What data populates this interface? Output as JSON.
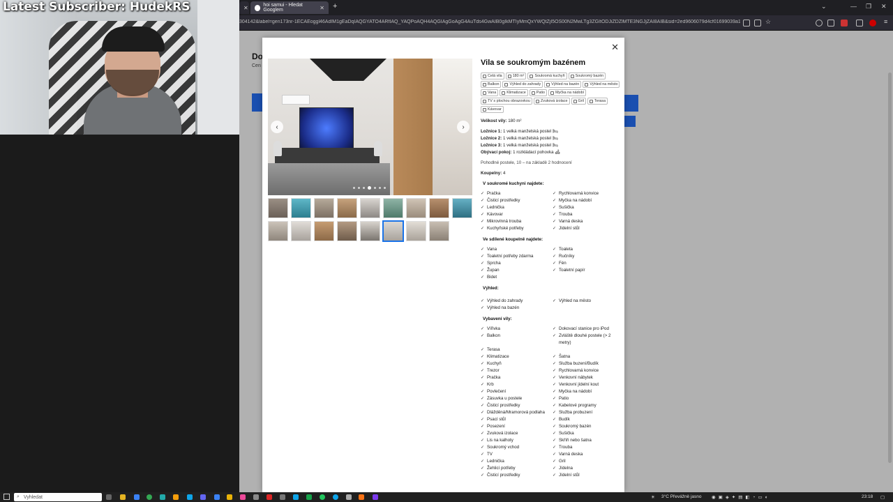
{
  "overlay": {
    "subscriber_text": "Latest Subscriber: HudekRS"
  },
  "browser": {
    "tabs": [
      {
        "label": ""
      },
      {
        "label": "hoi samui - Hledat Googlem"
      }
    ],
    "url": "304142&label=gen173nr-1ECAEoggl46AdIM1gEaDqIAQGYATO4ARfIAQ_YAQPoAQH4AQGIAgGoAgG4AuTds4GwAIB0gIkMTIyMmQxYWQtZjI5OS00N2MwLTg3ZGItODJiZDZlMTE3NGJjZAI8AIB&sid=2ed9606079d4cf01699039a1e7c693"
  },
  "background": {
    "heading": "Do",
    "subheading": "Cen"
  },
  "modal": {
    "title": "Vila se soukromým bazénem",
    "chips": [
      "Celá vila",
      "180 m²",
      "Soukromá kuchyň",
      "Soukromý bazén",
      "Balkon",
      "Výhled do zahrady",
      "Výhled na bazén",
      "Výhled na město",
      "Vana",
      "Klimatizace",
      "Patio",
      "Myčka na nádobí",
      "TV s plochou obrazovkou",
      "Zvuková izolace",
      "Gril",
      "Terasa",
      "Kávovar"
    ],
    "size_label": "Velikost vily:",
    "size_value": "180 m²",
    "rooms": [
      {
        "label": "Ložnice 1:",
        "value": "1 velká manželská postel 🛏"
      },
      {
        "label": "Ložnice 2:",
        "value": "1 velká manželská postel 🛏"
      },
      {
        "label": "Ložnice 3:",
        "value": "1 velká manželská postel 🛏"
      },
      {
        "label": "Obývací pokoj:",
        "value": "1 rozkládací pohovka 🛋"
      }
    ],
    "comfort_note": "Pohodlné postele, 10 – na základě 2 hodnocení",
    "bathrooms_label": "Koupelny:",
    "bathrooms_value": "4",
    "kitchen_heading": "V soukromé kuchyni najdete:",
    "kitchen": [
      "Pračka",
      "Rychlovarná konvice",
      "Čisticí prostředky",
      "Myčka na nádobí",
      "Lednička",
      "Sušička",
      "Kávovar",
      "Trouba",
      "Mikrovlnná trouba",
      "Varná deska",
      "Kuchyňské potřeby",
      "Jídelní stůl"
    ],
    "bath_heading": "Ve sdílené koupelně najdete:",
    "bath": [
      "Vana",
      "Toaleta",
      "Toaletní potřeby zdarma",
      "Ručníky",
      "Sprcha",
      "Fén",
      "Župan",
      "Toaletní papír",
      "Bidet",
      ""
    ],
    "view_heading": "Výhled:",
    "view": [
      "Výhled do zahrady",
      "Výhled na město",
      "Výhled na bazén",
      ""
    ],
    "equip_heading": "Vybavení vily:",
    "equip": [
      "Vířivka",
      "Dokovací stanice pro iPod",
      "Balkon",
      "Zvláště dlouhé postele (> 2 metry)",
      "Terasa",
      "",
      "Klimatizace",
      "Šatna",
      "Kuchyň",
      "Služba buzení/Budík",
      "Trezor",
      "Rychlovarná konvice",
      "Pračka",
      "Venkovní nábytek",
      "Krb",
      "Venkovní jídelní kout",
      "Povlečení",
      "Myčka na nádobí",
      "Zásuvka u postele",
      "Patio",
      "Čisticí prostředky",
      "Kabelové programy",
      "Dlážděná/Mramorová podlaha",
      "Služba probuzení",
      "Psací stůl",
      "Budík",
      "Posezení",
      "Soukromý bazén",
      "Zvuková izolace",
      "Sušička",
      "Lis na kalhoty",
      "Skříň nebo šatna",
      "Soukromý vchod",
      "Trouba",
      "TV",
      "Varná deska",
      "Lednička",
      "Gril",
      "Žehlicí potřeby",
      "Jídelna",
      "Čisticí prostředky",
      "Jídelní stůl"
    ]
  },
  "taskbar": {
    "search_placeholder": "Vyhledat",
    "weather": "3°C  Převážně jasno",
    "time": "23:18"
  }
}
